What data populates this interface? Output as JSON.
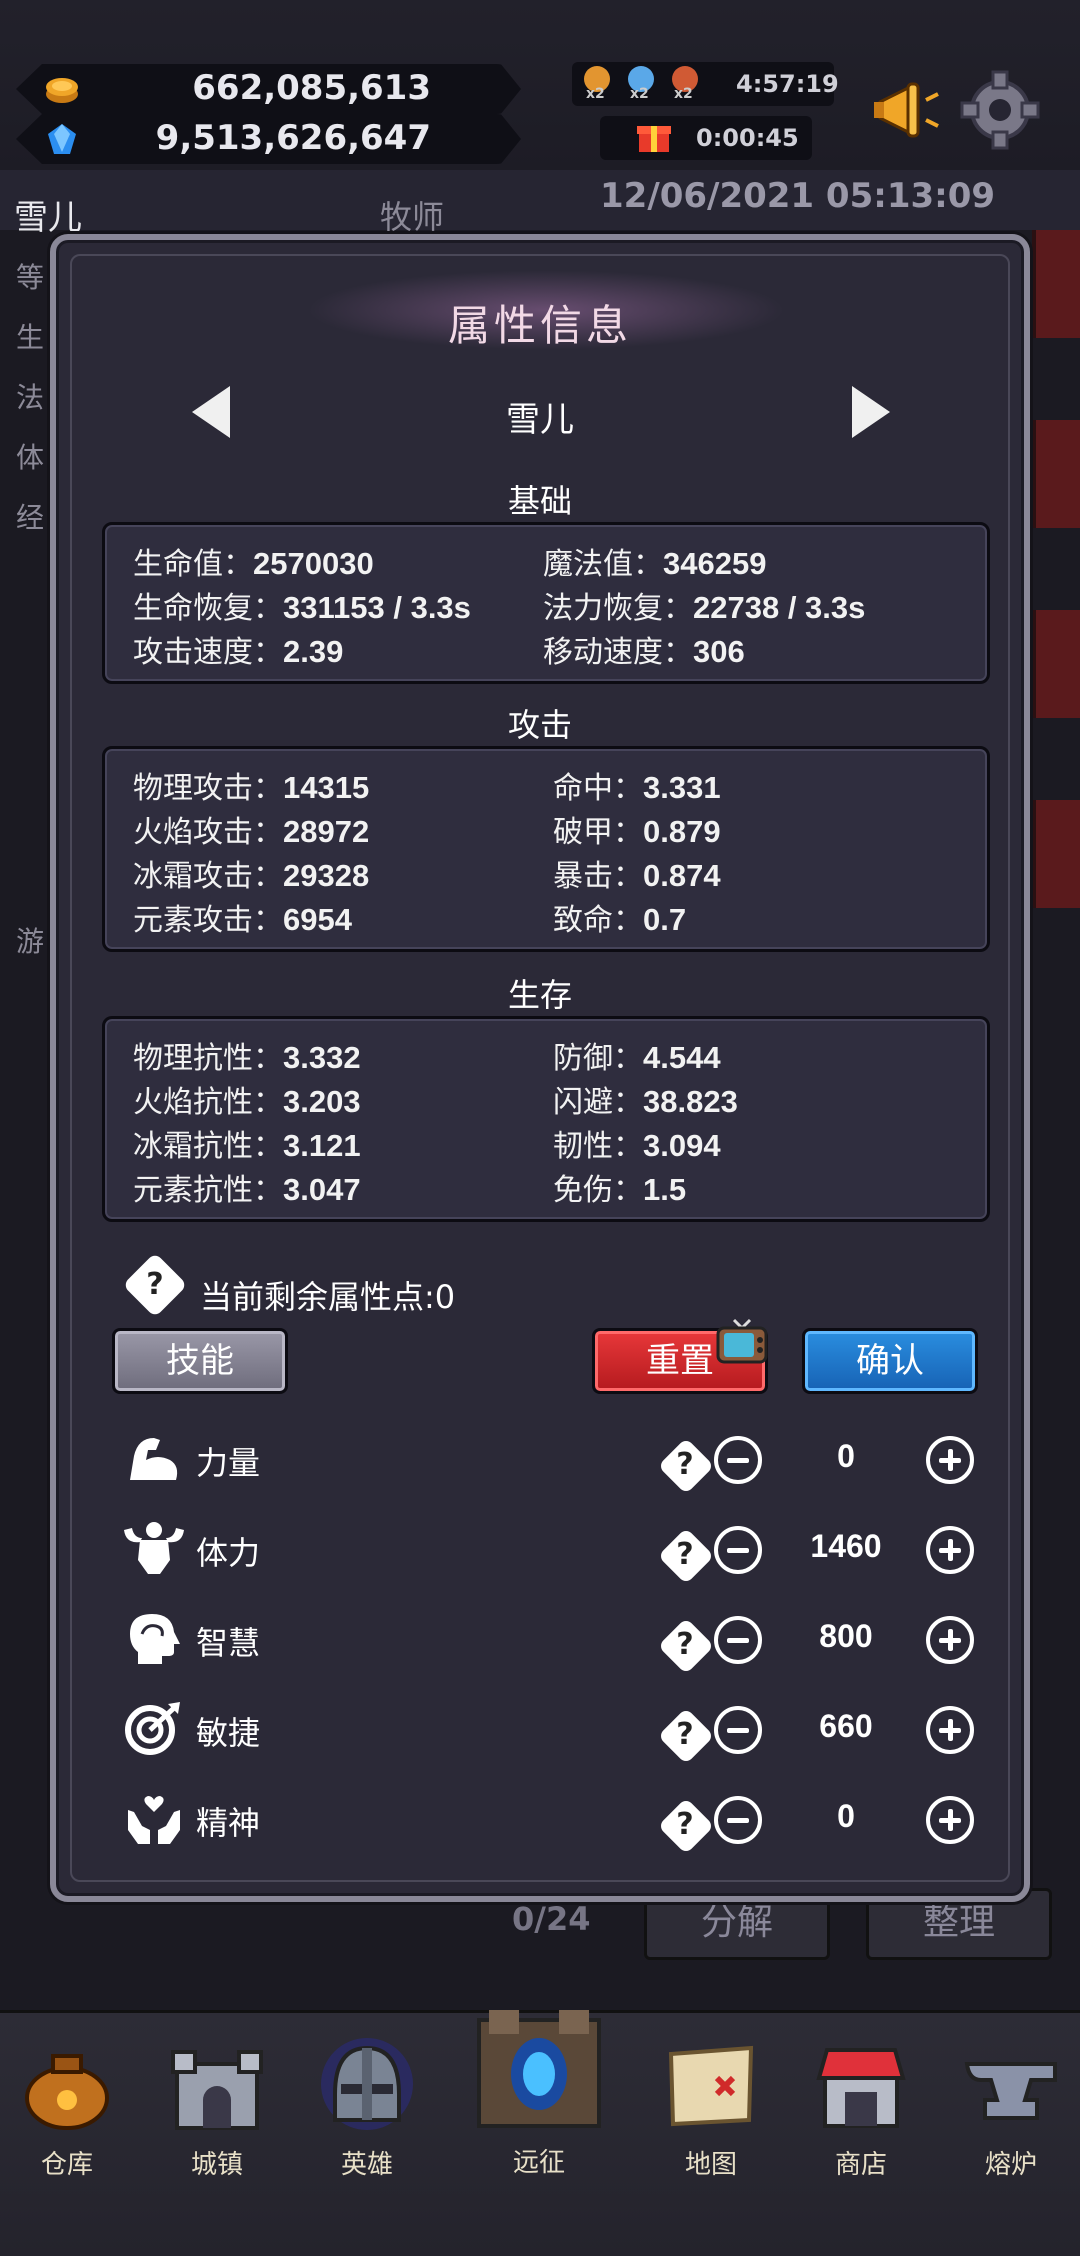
{
  "top_bar": {
    "gold": "662,085,613",
    "gems": "9,513,626,647",
    "buff_multiplier": "x2",
    "timer_main": "4:57:19",
    "timer_gift": "0:00:45"
  },
  "background": {
    "hero_name": "雪儿",
    "hero_class": "牧师",
    "datetime": "12/06/2021 05:13:09",
    "left_labels": [
      "等",
      "生",
      "法",
      "体",
      "经",
      "游"
    ],
    "inventory_count": "0/24",
    "decompose_label": "分解",
    "sort_label": "整理"
  },
  "modal": {
    "title": "属性信息",
    "character": "雪儿",
    "sections": {
      "basic": {
        "title": "基础",
        "left": [
          {
            "label": "生命值：",
            "value": "2570030"
          },
          {
            "label": "生命恢复：",
            "value": "331153 / 3.3s"
          },
          {
            "label": "攻击速度：",
            "value": "2.39"
          }
        ],
        "right": [
          {
            "label": "魔法值：",
            "value": "346259"
          },
          {
            "label": "法力恢复：",
            "value": "22738 / 3.3s"
          },
          {
            "label": "移动速度：",
            "value": "306"
          }
        ]
      },
      "attack": {
        "title": "攻击",
        "left": [
          {
            "label": "物理攻击：",
            "value": "14315"
          },
          {
            "label": "火焰攻击：",
            "value": "28972"
          },
          {
            "label": "冰霜攻击：",
            "value": "29328"
          },
          {
            "label": "元素攻击：",
            "value": "6954"
          }
        ],
        "right": [
          {
            "label": "命中：",
            "value": "3.331"
          },
          {
            "label": "破甲：",
            "value": "0.879"
          },
          {
            "label": "暴击：",
            "value": "0.874"
          },
          {
            "label": "致命：",
            "value": "0.7"
          }
        ]
      },
      "survival": {
        "title": "生存",
        "left": [
          {
            "label": "物理抗性：",
            "value": "3.332"
          },
          {
            "label": "火焰抗性：",
            "value": "3.203"
          },
          {
            "label": "冰霜抗性：",
            "value": "3.121"
          },
          {
            "label": "元素抗性：",
            "value": "3.047"
          }
        ],
        "right": [
          {
            "label": "防御：",
            "value": "4.544"
          },
          {
            "label": "闪避：",
            "value": "38.823"
          },
          {
            "label": "韧性：",
            "value": "3.094"
          },
          {
            "label": "免伤：",
            "value": "1.5"
          }
        ]
      }
    },
    "remaining_points_text": "当前剩余属性点:0",
    "buttons": {
      "skill": "技能",
      "reset": "重置",
      "confirm": "确认"
    },
    "attributes": [
      {
        "name": "力量",
        "value": "0",
        "icon": "muscle-arm-icon"
      },
      {
        "name": "体力",
        "value": "1460",
        "icon": "flexing-body-icon"
      },
      {
        "name": "智慧",
        "value": "800",
        "icon": "head-brain-icon"
      },
      {
        "name": "敏捷",
        "value": "660",
        "icon": "target-arrow-icon"
      },
      {
        "name": "精神",
        "value": "0",
        "icon": "hands-heart-icon"
      }
    ]
  },
  "nav": [
    {
      "label": "仓库",
      "icon": "bag-icon"
    },
    {
      "label": "城镇",
      "icon": "castle-icon"
    },
    {
      "label": "英雄",
      "icon": "helmet-icon"
    },
    {
      "label": "远征",
      "icon": "portal-icon"
    },
    {
      "label": "地图",
      "icon": "map-icon"
    },
    {
      "label": "商店",
      "icon": "shop-icon"
    },
    {
      "label": "熔炉",
      "icon": "anvil-icon"
    }
  ]
}
